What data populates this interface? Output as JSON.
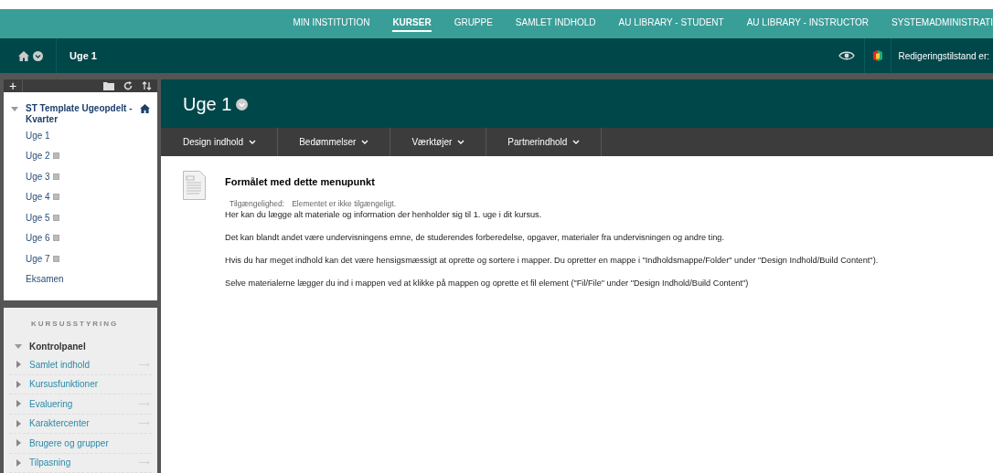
{
  "top_nav": [
    {
      "label": "MIN INSTITUTION",
      "selected": false
    },
    {
      "label": "KURSER",
      "selected": true
    },
    {
      "label": "GRUPPE",
      "selected": false
    },
    {
      "label": "SAMLET INDHOLD",
      "selected": false
    },
    {
      "label": "AU LIBRARY - STUDENT",
      "selected": false
    },
    {
      "label": "AU LIBRARY - INSTRUCTOR",
      "selected": false
    },
    {
      "label": "SYSTEMADMINISTRATI",
      "selected": false
    }
  ],
  "breadcrumb": {
    "current": "Uge 1"
  },
  "edit_mode": {
    "label": "Redigeringstilstand er:"
  },
  "sidebar": {
    "toolbar": {
      "add": "+"
    },
    "course": {
      "title": "ST Template Ugeopdelt - Kvarter",
      "expanded": true,
      "items": [
        {
          "label": "Uge 1",
          "hidden": false
        },
        {
          "label": "Uge 2",
          "hidden": true
        },
        {
          "label": "Uge 3",
          "hidden": true
        },
        {
          "label": "Uge 4",
          "hidden": true
        },
        {
          "label": "Uge 5",
          "hidden": true
        },
        {
          "label": "Uge 6",
          "hidden": true
        },
        {
          "label": "Uge 7",
          "hidden": true
        },
        {
          "label": "Eksamen",
          "hidden": false
        }
      ]
    },
    "management": {
      "heading": "KURSUSSTYRING",
      "panel": {
        "title": "Kontrolpanel",
        "expanded": true
      },
      "items": [
        {
          "label": "Samlet indhold",
          "link_arrow": true
        },
        {
          "label": "Kursusfunktioner",
          "link_arrow": false
        },
        {
          "label": "Evaluering",
          "link_arrow": true
        },
        {
          "label": "Karaktercenter",
          "link_arrow": true
        },
        {
          "label": "Brugere og grupper",
          "link_arrow": false
        },
        {
          "label": "Tilpasning",
          "link_arrow": true
        }
      ]
    }
  },
  "page": {
    "title": "Uge 1",
    "menu": [
      "Design indhold",
      "Bedømmelser",
      "Værktøjer",
      "Partnerindhold"
    ],
    "item": {
      "title": "Formålet med dette menupunkt",
      "availability_label": "Tilgængelighed:",
      "availability_value": "Elementet er ikke tilgængeligt.",
      "paragraphs": [
        "Her kan du lægge alt materiale og information der henholder sig til 1. uge i dit kursus.",
        "Det kan blandt andet være undervisningens emne, de studerendes forberedelse, opgaver, materialer fra undervisningen og andre ting.",
        "Hvis du har meget indhold kan det være hensigsmæssigt at oprette og sortere i mapper. Du opretter en mappe i \"Indholdsmappe/Folder\" under \"Design Indhold/Build Content\").",
        "Selve materialerne lægger du ind i mappen ved at klikke på mappen og oprette et fil element (\"Fil/File\" under \"Design Indhold/Build Content\")"
      ]
    }
  }
}
